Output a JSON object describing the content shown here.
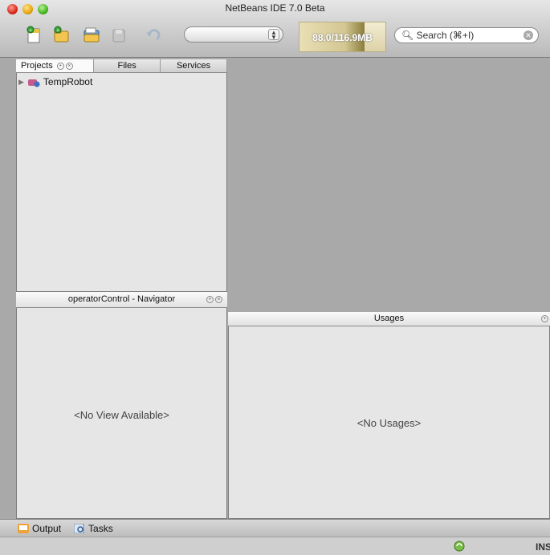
{
  "window": {
    "title": "NetBeans IDE 7.0 Beta"
  },
  "toolbar": {
    "buttons": [
      {
        "name": "new-file-icon"
      },
      {
        "name": "new-project-icon"
      },
      {
        "name": "open-project-icon"
      },
      {
        "name": "save-all-icon"
      },
      {
        "name": "undo-icon"
      }
    ],
    "config_value": "",
    "memory": {
      "label": "88.0/116.9MB",
      "used_fraction": 0.753
    },
    "search_placeholder": "Search (⌘+I)"
  },
  "projects_panel": {
    "tabs": [
      "Projects",
      "Files",
      "Services"
    ],
    "tree": [
      {
        "label": "TempRobot"
      }
    ]
  },
  "navigator": {
    "title": "operatorControl - Navigator",
    "empty": "<No View Available>"
  },
  "usages": {
    "title": "Usages",
    "empty": "<No Usages>"
  },
  "bottom_tabs": [
    "Output",
    "Tasks"
  ],
  "status": {
    "mode": "INS"
  },
  "colors": {
    "accent": "#e8c34a",
    "panel": "#e6e6e6",
    "editor": "#a9a9a9"
  }
}
